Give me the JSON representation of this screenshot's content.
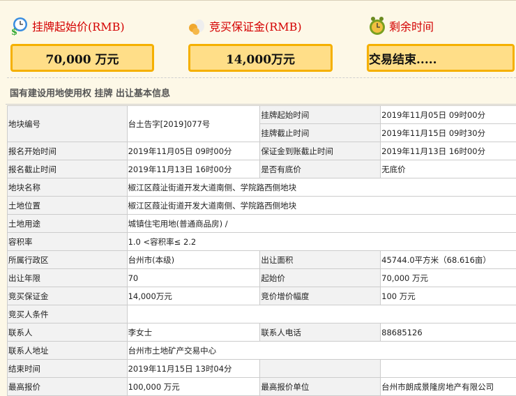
{
  "summary": {
    "start_price": {
      "label": "挂牌起始价(RMB)",
      "value": "70,000 万元",
      "icon": "clock-money-icon"
    },
    "deposit": {
      "label": "竞买保证金(RMB)",
      "value": "14,000万元",
      "icon": "money-bag-icon"
    },
    "remaining": {
      "label": "剩余时间",
      "value": "交易结束.....",
      "icon": "alarm-clock-icon"
    }
  },
  "section_title": "国有建设用地使用权 挂牌 出让基本信息",
  "table": {
    "r1": {
      "l1": "地块编号",
      "v1": "台土告字[2019]077号",
      "l2a": "挂牌起始时间",
      "v2a": "2019年11月05日 09时00分",
      "l2b": "挂牌截止时间",
      "v2b": "2019年11月15日 09时30分"
    },
    "rows": [
      {
        "l1": "报名开始时间",
        "v1": "2019年11月05日 09时00分",
        "l2": "保证金到账截止时间",
        "v2": "2019年11月13日 16时00分"
      },
      {
        "l1": "报名截止时间",
        "v1": "2019年11月13日 16时00分",
        "l2": "是否有底价",
        "v2": "无底价"
      },
      {
        "l1": "地块名称",
        "v1": "椒江区葭沚街道开发大道南侧、学院路西侧地块"
      },
      {
        "l1": "土地位置",
        "v1": "椒江区葭沚街道开发大道南侧、学院路西侧地块"
      },
      {
        "l1": "土地用途",
        "v1": "城镇住宅用地(普通商品房) /"
      },
      {
        "l1": "容积率",
        "v1": "1.0 <容积率≤ 2.2"
      },
      {
        "l1": "所属行政区",
        "v1": "台州市(本级)",
        "l2": "出让面积",
        "v2": "45744.0平方米（68.616亩）"
      },
      {
        "l1": "出让年限",
        "v1": "70",
        "l2": "起始价",
        "v2": "70,000 万元"
      },
      {
        "l1": "竞买保证金",
        "v1": "14,000万元",
        "l2": "竞价增价幅度",
        "v2": "100 万元"
      },
      {
        "l1": "竞买人条件",
        "v1": ""
      },
      {
        "l1": "联系人",
        "v1": "李女士",
        "l2": "联系人电话",
        "v2": "88685126"
      },
      {
        "l1": "联系人地址",
        "v1": "台州市土地矿产交易中心"
      },
      {
        "l1": "结束时间",
        "v1": "2019年11月15日 13时04分",
        "l2": "",
        "v2": ""
      },
      {
        "l1": "最高报价",
        "v1": "100,000 万元",
        "l2": "最高报价单位",
        "v2": "台州市朗成景隆房地产有限公司"
      }
    ]
  }
}
